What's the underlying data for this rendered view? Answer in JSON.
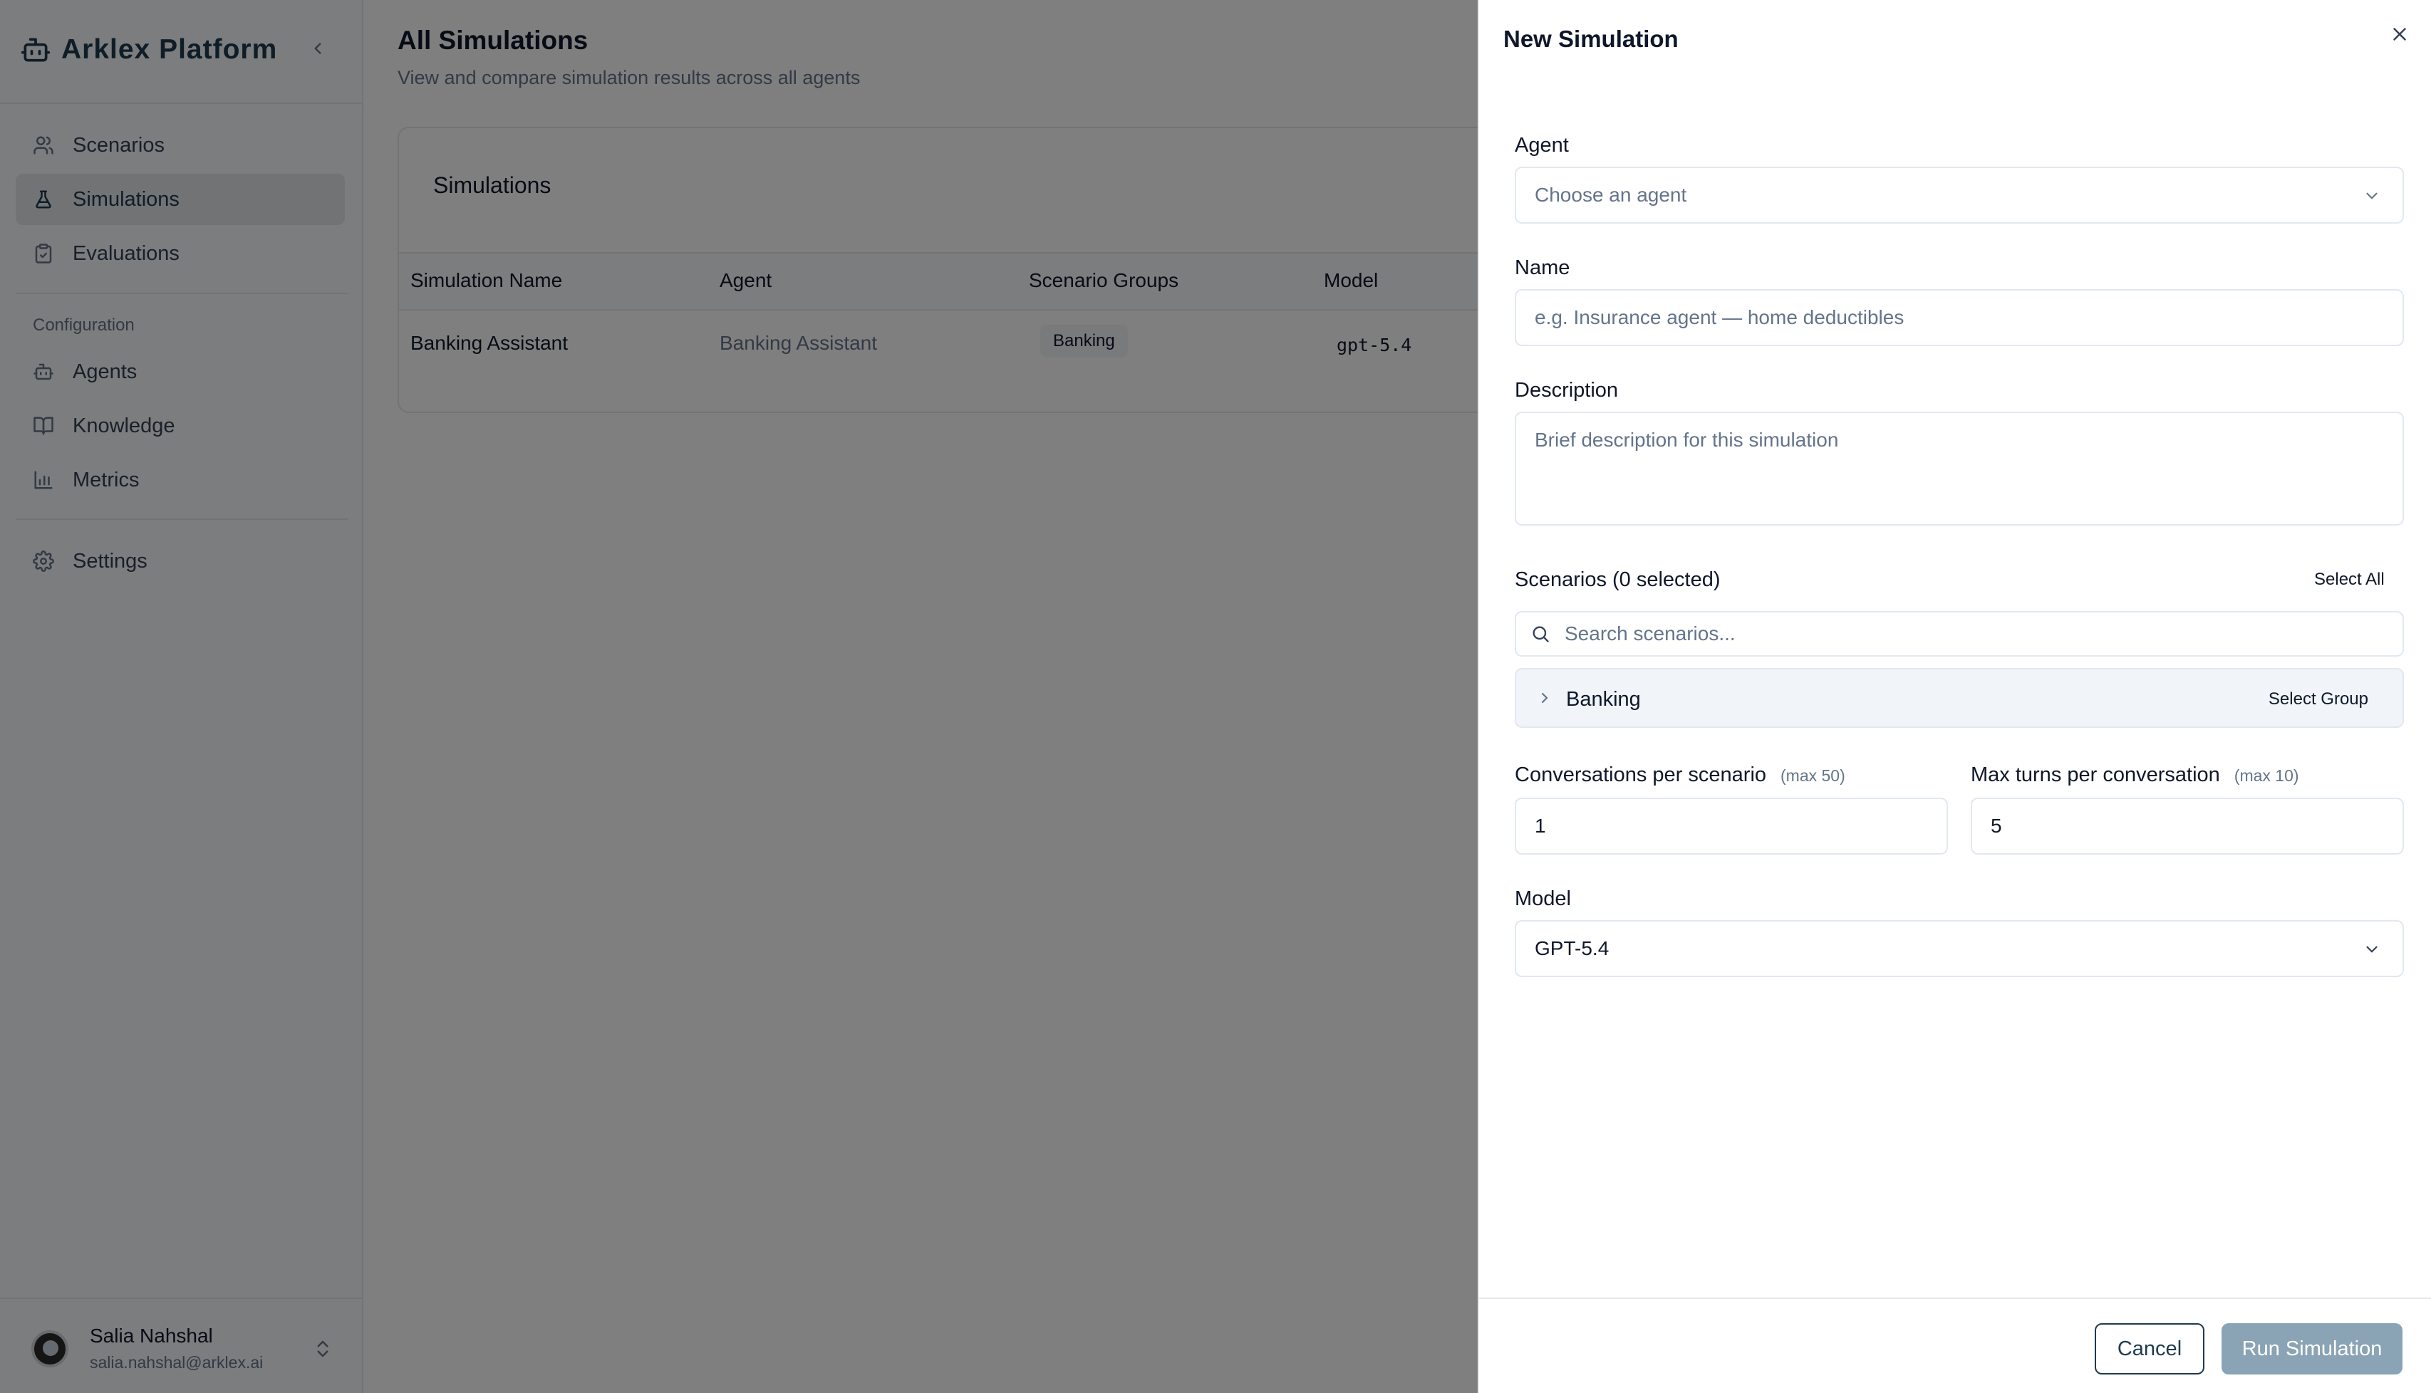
{
  "sidebar": {
    "brand": "Arklex Platform",
    "nav": [
      {
        "label": "Scenarios",
        "icon": "users-icon"
      },
      {
        "label": "Simulations",
        "icon": "flask-icon",
        "active": true
      },
      {
        "label": "Evaluations",
        "icon": "clipboard-icon"
      }
    ],
    "config_label": "Configuration",
    "config_nav": [
      {
        "label": "Agents",
        "icon": "bot-icon"
      },
      {
        "label": "Knowledge",
        "icon": "book-icon"
      },
      {
        "label": "Metrics",
        "icon": "bar-chart-icon"
      }
    ],
    "settings": {
      "label": "Settings",
      "icon": "gear-icon"
    },
    "user": {
      "name": "Salia Nahshal",
      "email": "salia.nahshal@arklex.ai"
    }
  },
  "main": {
    "title": "All Simulations",
    "subtitle": "View and compare simulation results across all agents",
    "card_title": "Simulations",
    "columns": [
      "Simulation Name",
      "Agent",
      "Scenario Groups",
      "Model"
    ],
    "rows": [
      {
        "name": "Banking Assistant",
        "agent": "Banking Assistant",
        "group": "Banking",
        "model": "gpt-5.4"
      }
    ]
  },
  "drawer": {
    "title": "New Simulation",
    "agent": {
      "label": "Agent",
      "placeholder": "Choose an agent"
    },
    "name": {
      "label": "Name",
      "placeholder": "e.g. Insurance agent — home deductibles"
    },
    "description": {
      "label": "Description",
      "placeholder": "Brief description for this simulation"
    },
    "scenarios": {
      "label": "Scenarios (0 selected)",
      "select_all": "Select All",
      "search_placeholder": "Search scenarios...",
      "groups": [
        {
          "name": "Banking",
          "select_label": "Select Group"
        }
      ]
    },
    "conversations": {
      "label": "Conversations per scenario",
      "hint": "(max 50)",
      "value": "1"
    },
    "max_turns": {
      "label": "Max turns per conversation",
      "hint": "(max 10)",
      "value": "5"
    },
    "model": {
      "label": "Model",
      "value": "GPT-5.4"
    },
    "cancel": "Cancel",
    "run": "Run Simulation"
  },
  "colors": {
    "brand": "#1e3a4f",
    "run_button": "#8aa3b5",
    "active_nav": "#e5e7eb"
  }
}
